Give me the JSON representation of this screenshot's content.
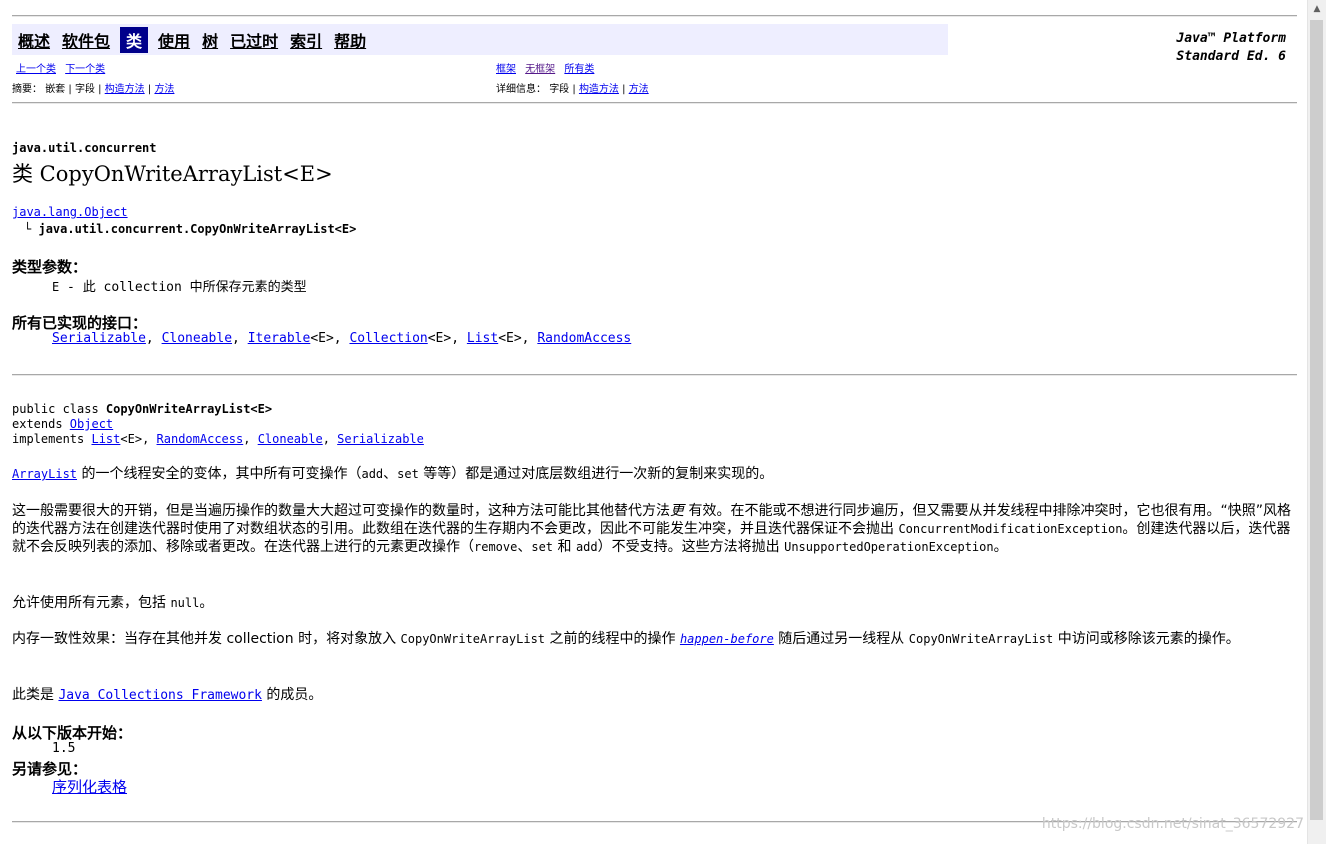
{
  "navbar": {
    "items": [
      "概述",
      "软件包",
      "类",
      "使用",
      "树",
      "已过时",
      "索引",
      "帮助"
    ],
    "active_index": 2
  },
  "platform": {
    "line1": "Java™ Platform",
    "line2": "Standard Ed. 6"
  },
  "subnav": {
    "prev_class": "上一个类",
    "next_class": "下一个类",
    "frames": "框架",
    "no_frames": "无框架",
    "all_classes": "所有类",
    "summary_label": "摘要：",
    "summary_nested": "嵌套",
    "summary_field": "字段",
    "summary_constructor": "构造方法",
    "summary_method": "方法",
    "detail_label": "详细信息：",
    "detail_field": "字段",
    "detail_constructor": "构造方法",
    "detail_method": "方法",
    "sep": "|"
  },
  "header": {
    "package": "java.util.concurrent",
    "title": "类 CopyOnWriteArrayList<E>",
    "hierarchy_parent": "java.lang.Object",
    "hierarchy_child": "java.util.concurrent.CopyOnWriteArrayList<E>",
    "tree_glyph": "└"
  },
  "type_params": {
    "label": "类型参数：",
    "name": "E",
    "desc": " - 此 collection 中所保存元素的类型"
  },
  "interfaces": {
    "label": "所有已实现的接口：",
    "items": [
      "Serializable",
      "Cloneable",
      "Iterable",
      "Collection",
      "List",
      "RandomAccess"
    ],
    "generic": "<E>",
    "comma": ", "
  },
  "signature": {
    "line1_prefix": "public class ",
    "line1_name": "CopyOnWriteArrayList<E>",
    "line2_prefix": "extends ",
    "line2_link": "Object",
    "line3_prefix": "implements ",
    "impl_list": "List",
    "impl_generic": "<E>",
    "impl_random": "RandomAccess",
    "impl_clone": "Cloneable",
    "impl_serial": "Serializable",
    "comma": ", "
  },
  "desc": {
    "p1_link": "ArrayList",
    "p1_a": " 的一个线程安全的变体，其中所有可变操作（",
    "p1_add": "add",
    "p1_b": "、",
    "p1_set": "set",
    "p1_c": " 等等）都是通过对底层数组进行一次新的复制来实现的。",
    "p2_a": "这一般需要很大的开销，但是当遍历操作的数量大大超过可变操作的数量时，这种方法可能比其他替代方法",
    "p2_more": "更",
    "p2_b": " 有效。在不能或不想进行同步遍历，但又需要从并发线程中排除冲突时，它也很有用。“快照”风格的迭代器方法在创建迭代器时使用了对数组状态的引用。此数组在迭代器的生存期内不会更改，因此不可能发生冲突，并且迭代器保证不会抛出 ",
    "p2_cme": "ConcurrentModificationException",
    "p2_c": "。创建迭代器以后，迭代器就不会反映列表的添加、移除或者更改。在迭代器上进行的元素更改操作（",
    "p2_remove": "remove",
    "p2_d": "、",
    "p2_set": "set",
    "p2_e": " 和 ",
    "p2_add": "add",
    "p2_f": "）不受支持。这些方法将抛出 ",
    "p2_uoe": "UnsupportedOperationException",
    "p2_g": "。",
    "p3_a": "允许使用所有元素，包括 ",
    "p3_null": "null",
    "p3_b": "。",
    "p4_a": "内存一致性效果：当存在其他并发 collection 时，将对象放入 ",
    "p4_cls1": "CopyOnWriteArrayList",
    "p4_b": " 之前的线程中的操作 ",
    "p4_link": "happen-before",
    "p4_c": " 随后通过另一线程从 ",
    "p4_cls2": "CopyOnWriteArrayList",
    "p4_d": " 中访问或移除该元素的操作。",
    "p5_a": "此类是 ",
    "p5_link": "Java Collections Framework",
    "p5_b": " 的成员。"
  },
  "since": {
    "label": "从以下版本开始：",
    "value": "1.5"
  },
  "see_also": {
    "label": "另请参见：",
    "link": "序列化表格"
  },
  "watermark": "https://blog.csdn.net/sinat_36572927"
}
